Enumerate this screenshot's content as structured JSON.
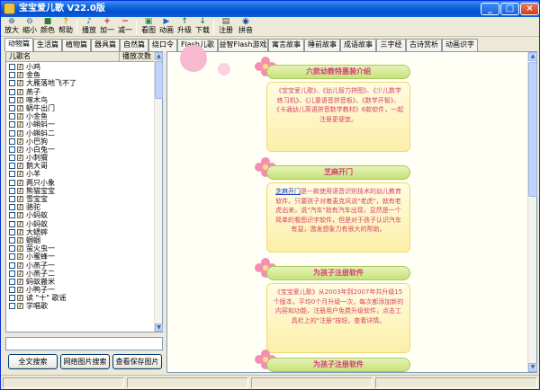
{
  "window": {
    "title": "宝宝爱儿歌 V22.0版",
    "minimize_glyph": "_",
    "maximize_glyph": "□",
    "close_glyph": "×"
  },
  "toolbar": [
    {
      "label": "放大",
      "icon": "zoom-in-icon",
      "glyph": "⊕"
    },
    {
      "label": "缩小",
      "icon": "zoom-out-icon",
      "glyph": "⊖"
    },
    {
      "label": "颜色",
      "icon": "color-icon",
      "glyph": "■"
    },
    {
      "label": "帮助",
      "icon": "help-icon",
      "glyph": "?"
    },
    {
      "label": "播放",
      "icon": "play-icon",
      "glyph": "♪"
    },
    {
      "label": "加一",
      "icon": "plus-icon",
      "glyph": "+"
    },
    {
      "label": "减一",
      "icon": "minus-icon",
      "glyph": "−"
    },
    {
      "label": "看图",
      "icon": "picture-icon",
      "glyph": "▣"
    },
    {
      "label": "动画",
      "icon": "animation-icon",
      "glyph": "▶"
    },
    {
      "label": "升级",
      "icon": "upgrade-icon",
      "glyph": "↑"
    },
    {
      "label": "下载",
      "icon": "download-icon",
      "glyph": "↓"
    },
    {
      "label": "注册",
      "icon": "register-icon",
      "glyph": "▤"
    },
    {
      "label": "拼音",
      "icon": "pinyin-icon",
      "glyph": "◉"
    }
  ],
  "tabs": [
    {
      "label": "动物篇",
      "active": true
    },
    {
      "label": "生活篇",
      "active": false
    },
    {
      "label": "植物篇",
      "active": false
    },
    {
      "label": "器具篇",
      "active": false
    },
    {
      "label": "自然篇",
      "active": false
    },
    {
      "label": "绕口令",
      "active": false
    },
    {
      "label": "Flash儿歌",
      "active": false
    },
    {
      "label": "益智Flash游戏",
      "active": false
    },
    {
      "label": "寓言故事",
      "active": false
    },
    {
      "label": "睡前故事",
      "active": false
    },
    {
      "label": "成语故事",
      "active": false
    },
    {
      "label": "三字经",
      "active": false
    },
    {
      "label": "古诗赏析",
      "active": false
    },
    {
      "label": "动画识字",
      "active": false
    }
  ],
  "song_list": {
    "col_name": "儿歌名",
    "col_count": "播放次数",
    "items": [
      "小鸡",
      "金鱼",
      "大雁落地飞不了",
      "燕子",
      "啄木鸟",
      "蜗牛出门",
      "小金鱼",
      "小蝌蚪一",
      "小蝌蚪二",
      "小巴狗",
      "小白兔一",
      "小刺猬",
      "鹅大哥",
      "小羊",
      "两只小象",
      "熊猫宝宝",
      "雪宝宝",
      "骆驼",
      "小蚂蚁",
      "小蚂蚁",
      "大蟋蟀",
      "蝈蝈",
      "萤火虫一",
      "小蜜蜂一",
      "小燕子一",
      "小燕子二",
      "蚂蚁搬米",
      "小鸭子一",
      "读 \"十\" 歌谣",
      "学唱歌"
    ]
  },
  "search": {
    "value": ""
  },
  "buttons": {
    "fulltext": "全文搜索",
    "netimage": "网络图片搜索",
    "viewsaved": "查看保存图片"
  },
  "cards": [
    {
      "title": "六款幼教特惠装介绍",
      "text": "《宝宝爱儿歌》、《幼儿智力拼图》、《少儿数学练习机》、《儿童语音拼音板》、《数学开智》、《卡通幼儿英语拼音数学教材》6款软件，一起注册更便宜。",
      "link": "幼儿智力拼图"
    },
    {
      "title": "芝麻开门",
      "text": "是一款使用语音识别技术的幼儿教育软件。只要孩子对着麦克风说\"老虎\"，就有老虎出来，说\"汽车\"就有汽车出现，显然是一个简单的看图识字软件，但是对于孩子认识汽车有益，激发想象力有很大的帮助。",
      "link": "芝麻开门"
    },
    {
      "title": "为孩子注册软件",
      "text": "《宝宝爱儿歌》从2003年到2007年共升级15个版本，平均0个月升级一次，每次都添加新的内容和功能，注册用户免费升级软件，点击工具栏上的\"注册\"按钮，查看详情。",
      "link": ""
    },
    {
      "title": "为孩子注册软件",
      "text": "",
      "link": ""
    }
  ]
}
